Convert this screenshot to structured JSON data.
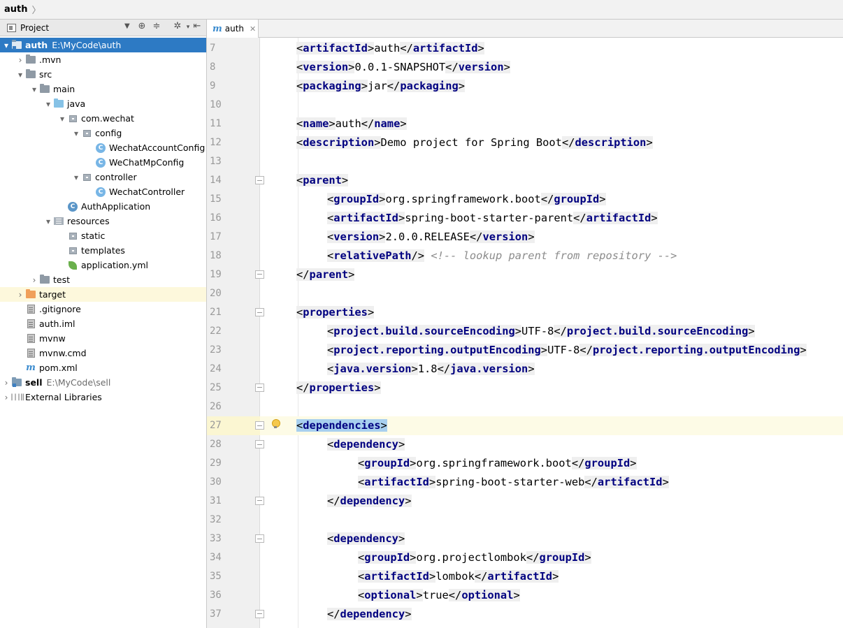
{
  "breadcrumb": {
    "project": "auth"
  },
  "panel": {
    "title": "Project"
  },
  "tree": [
    {
      "arrow": "▾",
      "icon": "module-folder-icon",
      "label": "auth",
      "path": "E:\\MyCode\\auth",
      "bold": true,
      "selected": true
    },
    {
      "arrow": "›",
      "icon": "folder-icon",
      "label": ".mvn"
    },
    {
      "arrow": "▾",
      "icon": "folder-icon",
      "label": "src"
    },
    {
      "arrow": "▾",
      "icon": "folder-icon",
      "label": "main"
    },
    {
      "arrow": "▾",
      "icon": "source-folder-icon",
      "label": "java"
    },
    {
      "arrow": "▾",
      "icon": "package-icon",
      "label": "com.wechat"
    },
    {
      "arrow": "▾",
      "icon": "package-icon",
      "label": "config"
    },
    {
      "arrow": "",
      "icon": "class-icon",
      "label": "WechatAccountConfig"
    },
    {
      "arrow": "",
      "icon": "class-icon",
      "label": "WeChatMpConfig"
    },
    {
      "arrow": "▾",
      "icon": "package-icon",
      "label": "controller"
    },
    {
      "arrow": "",
      "icon": "class-icon",
      "label": "WechatController"
    },
    {
      "arrow": "",
      "icon": "spring-boot-class-icon",
      "label": "AuthApplication"
    },
    {
      "arrow": "▾",
      "icon": "resources-folder-icon",
      "label": "resources"
    },
    {
      "arrow": "",
      "icon": "package-icon",
      "label": "static"
    },
    {
      "arrow": "",
      "icon": "package-icon",
      "label": "templates"
    },
    {
      "arrow": "",
      "icon": "spring-yaml-icon",
      "label": "application.yml"
    },
    {
      "arrow": "›",
      "icon": "folder-icon",
      "label": "test"
    },
    {
      "arrow": "›",
      "icon": "excluded-folder-icon",
      "label": "target",
      "excluded": true
    },
    {
      "arrow": "",
      "icon": "text-file-icon",
      "label": ".gitignore"
    },
    {
      "arrow": "",
      "icon": "module-file-icon",
      "label": "auth.iml"
    },
    {
      "arrow": "",
      "icon": "text-file-icon",
      "label": "mvnw"
    },
    {
      "arrow": "",
      "icon": "text-file-icon",
      "label": "mvnw.cmd"
    },
    {
      "arrow": "",
      "icon": "maven-icon",
      "label": "pom.xml"
    },
    {
      "arrow": "›",
      "icon": "module-folder-icon",
      "label": "sell",
      "path": "E:\\MyCode\\sell",
      "bold": true
    },
    {
      "arrow": "›",
      "icon": "libraries-icon",
      "label": "External Libraries"
    }
  ],
  "editor": {
    "tab_label": "auth",
    "lines": [
      {
        "n": "7",
        "text": "<artifactId>auth</artifactId>",
        "indent": 1
      },
      {
        "n": "8",
        "text": "<version>0.0.1-SNAPSHOT</version>",
        "indent": 1
      },
      {
        "n": "9",
        "text": "<packaging>jar</packaging>",
        "indent": 1
      },
      {
        "n": "10",
        "text": "",
        "indent": 0
      },
      {
        "n": "11",
        "text": "<name>auth</name>",
        "indent": 1
      },
      {
        "n": "12",
        "text": "<description>Demo project for Spring Boot</description>",
        "indent": 1
      },
      {
        "n": "13",
        "text": "",
        "indent": 0
      },
      {
        "n": "14",
        "text": "<parent>",
        "indent": 1,
        "fold": "open"
      },
      {
        "n": "15",
        "text": "<groupId>org.springframework.boot</groupId>",
        "indent": 2
      },
      {
        "n": "16",
        "text": "<artifactId>spring-boot-starter-parent</artifactId>",
        "indent": 2
      },
      {
        "n": "17",
        "text": "<version>2.0.0.RELEASE</version>",
        "indent": 2
      },
      {
        "n": "18",
        "text": "<relativePath/> <!-- lookup parent from repository -->",
        "indent": 2
      },
      {
        "n": "19",
        "text": "</parent>",
        "indent": 1,
        "fold": "close"
      },
      {
        "n": "20",
        "text": "",
        "indent": 0
      },
      {
        "n": "21",
        "text": "<properties>",
        "indent": 1,
        "fold": "open"
      },
      {
        "n": "22",
        "text": "<project.build.sourceEncoding>UTF-8</project.build.sourceEncoding>",
        "indent": 2
      },
      {
        "n": "23",
        "text": "<project.reporting.outputEncoding>UTF-8</project.reporting.outputEncoding>",
        "indent": 2
      },
      {
        "n": "24",
        "text": "<java.version>1.8</java.version>",
        "indent": 2
      },
      {
        "n": "25",
        "text": "</properties>",
        "indent": 1,
        "fold": "close"
      },
      {
        "n": "26",
        "text": "",
        "indent": 0
      },
      {
        "n": "27",
        "text": "<dependencies>",
        "indent": 1,
        "fold": "open",
        "current": true,
        "bulb": true,
        "match": true
      },
      {
        "n": "28",
        "text": "<dependency>",
        "indent": 2,
        "fold": "open"
      },
      {
        "n": "29",
        "text": "<groupId>org.springframework.boot</groupId>",
        "indent": 3
      },
      {
        "n": "30",
        "text": "<artifactId>spring-boot-starter-web</artifactId>",
        "indent": 3
      },
      {
        "n": "31",
        "text": "</dependency>",
        "indent": 2,
        "fold": "close"
      },
      {
        "n": "32",
        "text": "",
        "indent": 0
      },
      {
        "n": "33",
        "text": "<dependency>",
        "indent": 2,
        "fold": "open"
      },
      {
        "n": "34",
        "text": "<groupId>org.projectlombok</groupId>",
        "indent": 3
      },
      {
        "n": "35",
        "text": "<artifactId>lombok</artifactId>",
        "indent": 3
      },
      {
        "n": "36",
        "text": "<optional>true</optional>",
        "indent": 3
      },
      {
        "n": "37",
        "text": "</dependency>",
        "indent": 2,
        "fold": "close"
      }
    ]
  },
  "colors": {
    "selection": "#2d7ac4",
    "tag_name": "#000080",
    "current_line": "#fdfbe6",
    "brace_match": "#a8d0ef",
    "comment": "#8c8c8c"
  }
}
